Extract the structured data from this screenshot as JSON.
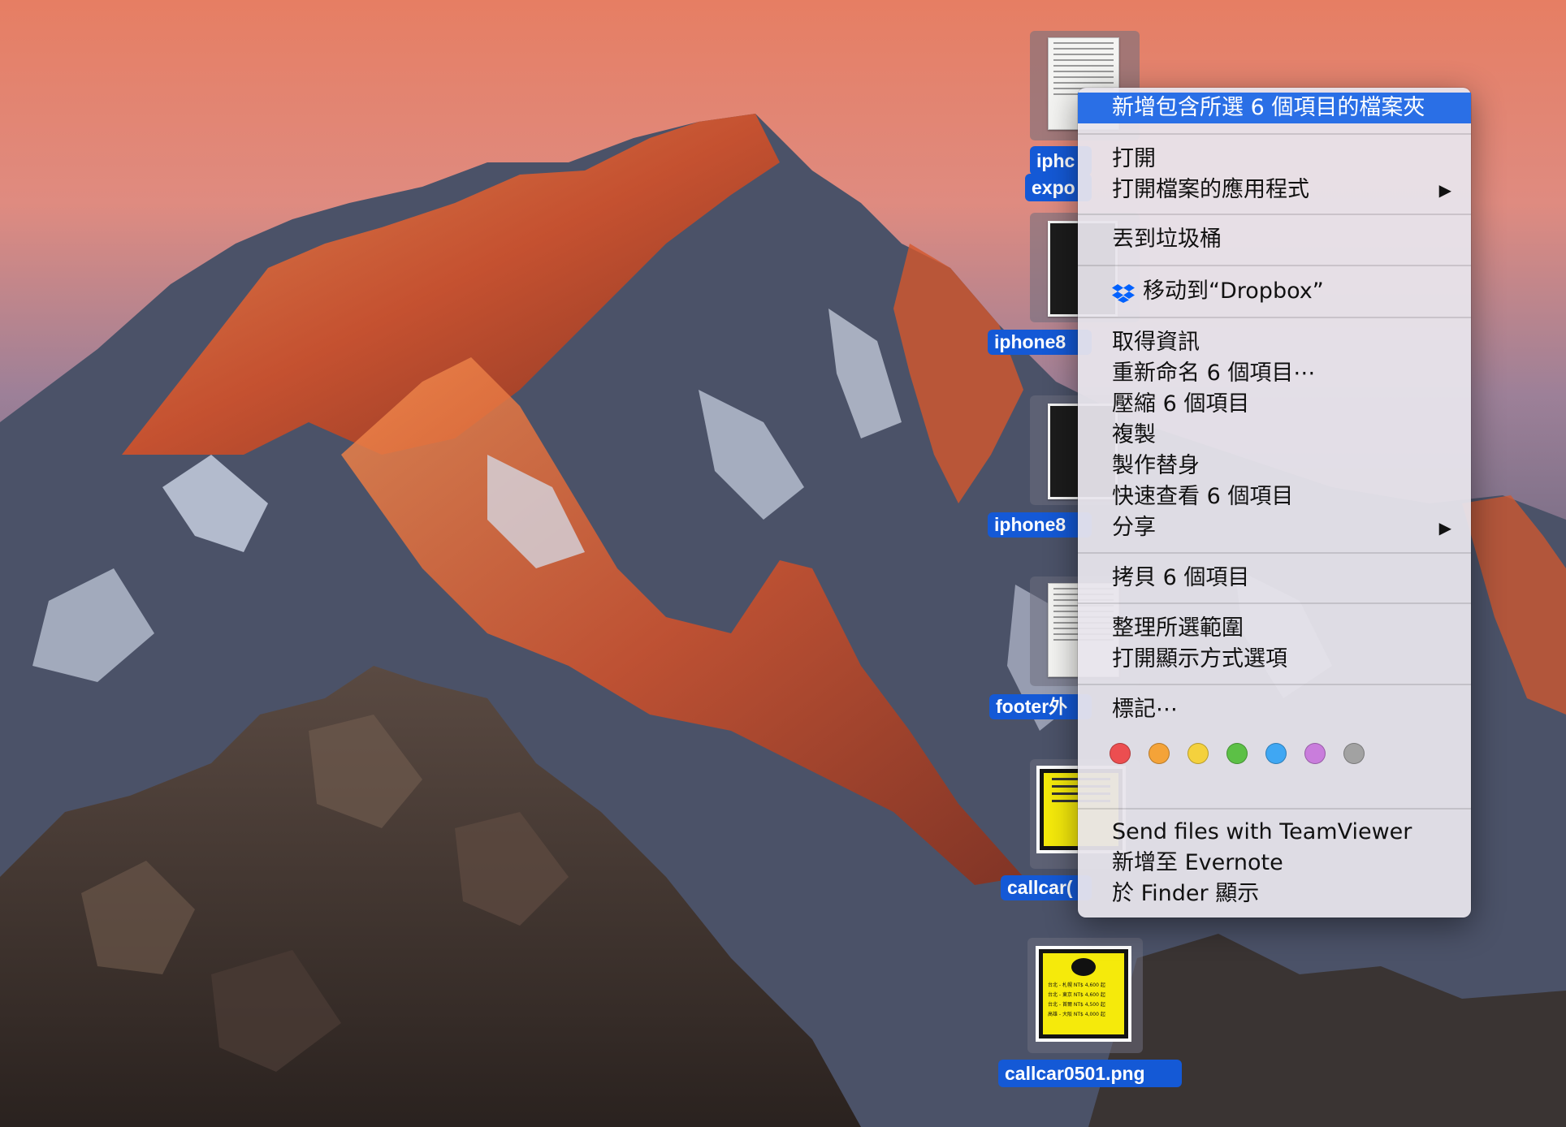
{
  "desktop": {
    "wallpaper": "macOS Sierra mountain",
    "icons": [
      {
        "name": "iphone-export-doc",
        "label_line1": "iphc",
        "label_line2": "expo"
      },
      {
        "name": "iphone8-a",
        "label": "iphone8"
      },
      {
        "name": "iphone8-b",
        "label": "iphone8"
      },
      {
        "name": "footer",
        "label": "footer外"
      },
      {
        "name": "callcar-a",
        "label": "callcar("
      },
      {
        "name": "callcar-b",
        "label": "callcar0501.png"
      }
    ],
    "poster_text": [
      "台北 - 札幌  NT$ 4,600 起",
      "台北 - 東京  NT$ 4,600 起",
      "台北 - 首爾  NT$ 4,500 起",
      "高雄 - 大阪  NT$ 4,000 起"
    ]
  },
  "menu": {
    "new_folder": "新增包含所選 6 個項目的檔案夾",
    "open": "打開",
    "open_with": "打開檔案的應用程式",
    "trash": "丟到垃圾桶",
    "dropbox": "移动到“Dropbox”",
    "get_info": "取得資訊",
    "rename": "重新命名 6 個項目⋯",
    "compress": "壓縮 6 個項目",
    "duplicate": "複製",
    "alias": "製作替身",
    "quicklook": "快速查看 6 個項目",
    "share": "分享",
    "copy": "拷貝 6 個項目",
    "cleanup": "整理所選範圍",
    "view_options": "打開顯示方式選項",
    "tags": "標記⋯",
    "teamviewer": "Send files with TeamViewer",
    "evernote": "新增至 Evernote",
    "reveal": "於 Finder 顯示",
    "submenu_arrow": "▶",
    "tag_colors": [
      "#ec4e50",
      "#f4a338",
      "#f4d13d",
      "#5cc046",
      "#3fa7f3",
      "#c97ddc",
      "#a2a2a2"
    ],
    "tag_names": [
      "red",
      "orange",
      "yellow",
      "green",
      "blue",
      "purple",
      "gray"
    ]
  },
  "colors": {
    "selection": "#1459d6",
    "menu_highlight": "#2a6fe6"
  }
}
